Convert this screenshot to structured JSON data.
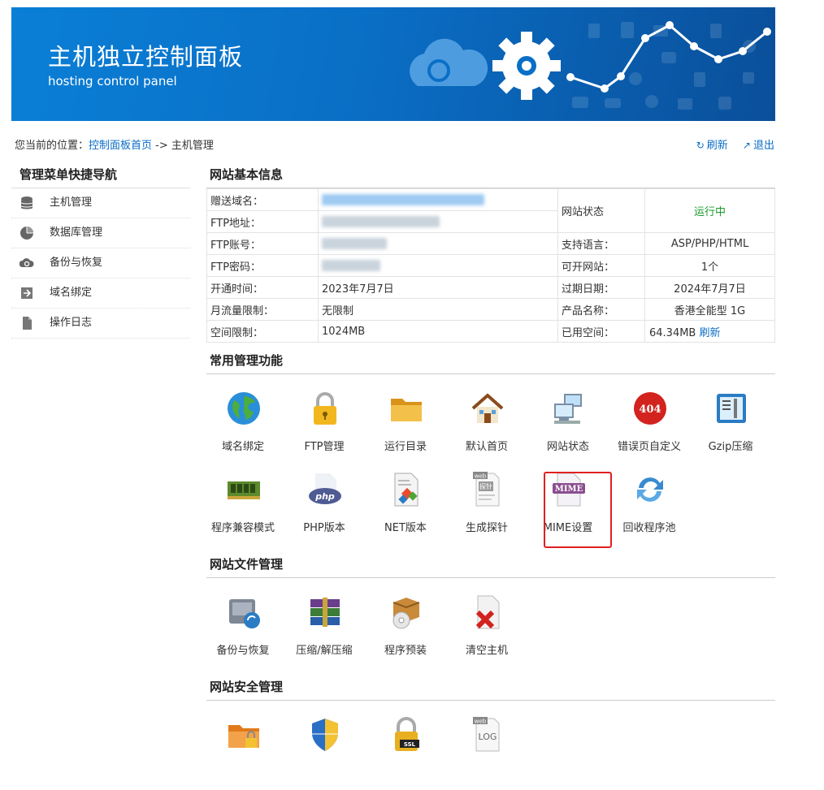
{
  "banner": {
    "title": "主机独立控制面板",
    "subtitle": "hosting control panel"
  },
  "breadcrumb": {
    "prefix": "您当前的位置：",
    "home": "控制面板首页",
    "sep": "->",
    "current": "主机管理"
  },
  "toplinks": {
    "refresh": "刷新",
    "logout": "退出"
  },
  "sidebar": {
    "title": "管理菜单快捷导航",
    "items": [
      {
        "label": "主机管理",
        "icon": "database-icon"
      },
      {
        "label": "数据库管理",
        "icon": "pie-chart-icon"
      },
      {
        "label": "备份与恢复",
        "icon": "cloud-sync-icon"
      },
      {
        "label": "域名绑定",
        "icon": "arrow-box-icon"
      },
      {
        "label": "操作日志",
        "icon": "document-icon"
      }
    ]
  },
  "info": {
    "title": "网站基本信息",
    "rows": [
      {
        "label": "赠送域名：",
        "value": "",
        "label2": "网站状态",
        "value2": "运行中"
      },
      {
        "label": "FTP地址：",
        "value": ""
      },
      {
        "label": "FTP账号：",
        "value": "",
        "label2": "支持语言：",
        "value2": "ASP/PHP/HTML"
      },
      {
        "label": "FTP密码：",
        "value": "",
        "label2": "可开网站：",
        "value2": "1个"
      },
      {
        "label": "开通时间：",
        "value": "2023年7月7日",
        "label2": "过期日期：",
        "value2": "2024年7月7日"
      },
      {
        "label": "月流量限制：",
        "value": "无限制",
        "label2": "产品名称：",
        "value2": "香港全能型 1G"
      },
      {
        "label": "空间限制：",
        "value": "1024MB",
        "label2": "已用空间：",
        "value2": "64.34MB",
        "link": "刷新"
      }
    ]
  },
  "common": {
    "title": "常用管理功能",
    "tiles": [
      {
        "label": "域名绑定",
        "icon": "globe-icon"
      },
      {
        "label": "FTP管理",
        "icon": "padlock-icon"
      },
      {
        "label": "运行目录",
        "icon": "folder-icon"
      },
      {
        "label": "默认首页",
        "icon": "house-icon"
      },
      {
        "label": "网站状态",
        "icon": "network-computers-icon"
      },
      {
        "label": "错误页自定义",
        "icon": "error-404-icon"
      },
      {
        "label": "Gzip压缩",
        "icon": "gzip-tool-icon"
      },
      {
        "label": "程序兼容模式",
        "icon": "memory-chip-icon"
      },
      {
        "label": "PHP版本",
        "icon": "php-icon"
      },
      {
        "label": "NET版本",
        "icon": "net-document-icon"
      },
      {
        "label": "生成探针",
        "icon": "probe-web-icon",
        "icon_text": "探针",
        "tag": "web"
      },
      {
        "label": "MIME设置",
        "icon": "mime-icon",
        "icon_text": "MIME"
      },
      {
        "label": "回收程序池",
        "icon": "recycle-arrows-icon"
      }
    ]
  },
  "files": {
    "title": "网站文件管理",
    "tiles": [
      {
        "label": "备份与恢复",
        "icon": "backup-drive-icon"
      },
      {
        "label": "压缩/解压缩",
        "icon": "archive-books-icon"
      },
      {
        "label": "程序预装",
        "icon": "package-cd-icon"
      },
      {
        "label": "清空主机",
        "icon": "delete-document-icon"
      }
    ]
  },
  "security": {
    "title": "网站安全管理",
    "icons": [
      {
        "icon": "folder-lock-icon"
      },
      {
        "icon": "shield-icon"
      },
      {
        "icon": "ssl-lock-icon",
        "icon_text": "SSL"
      },
      {
        "icon": "log-document-icon",
        "icon_text": "LOG",
        "tag": "web"
      }
    ]
  },
  "colors": {
    "accent": "#0a6cc6",
    "status_ok": "#1a9a2a",
    "highlight": "#e02020",
    "banner": "#0a6fc6"
  }
}
